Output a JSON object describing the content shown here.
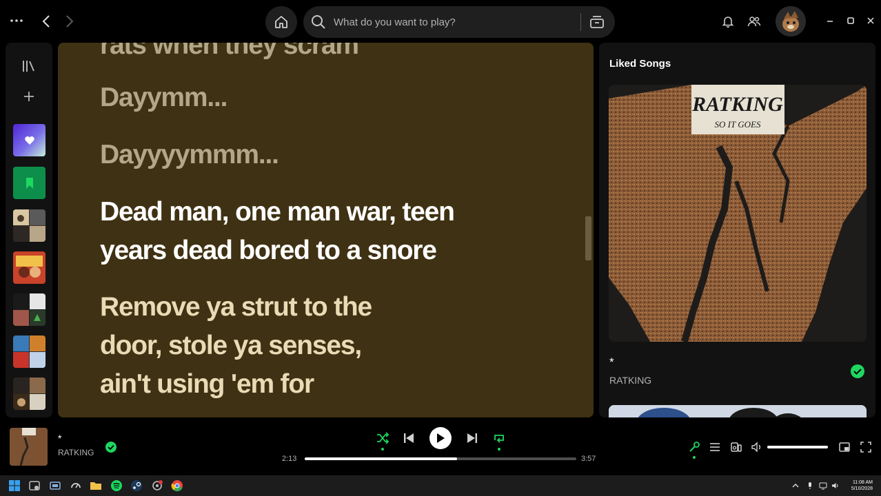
{
  "topbar": {
    "search_placeholder": "What do you want to play?"
  },
  "lyrics": {
    "cut_line": "rats when they scram",
    "lines_past": [
      "Dayymm...",
      "Dayyyymmm..."
    ],
    "active_line": [
      "Dead man, one man war, teen",
      "years dead bored to a snore"
    ],
    "next_line": [
      "Remove ya strut to the",
      "door, stole ya senses,",
      "ain't using 'em for"
    ],
    "bg_color": "#3f3113"
  },
  "right_panel": {
    "title": "Liked Songs",
    "track_title": "*",
    "artist": "RATKING",
    "album_logo_text": "RATKING",
    "album_sub_text": "SO IT GOES"
  },
  "player": {
    "track_title": "*",
    "artist": "RATKING",
    "elapsed": "2:13",
    "total": "3:57",
    "progress_fraction": 0.56,
    "volume_fraction": 1.0
  },
  "taskbar": {
    "time": "11:08 AM",
    "date": "5/10/2028"
  },
  "colors": {
    "accent": "#1ed760",
    "surface": "#121212"
  }
}
